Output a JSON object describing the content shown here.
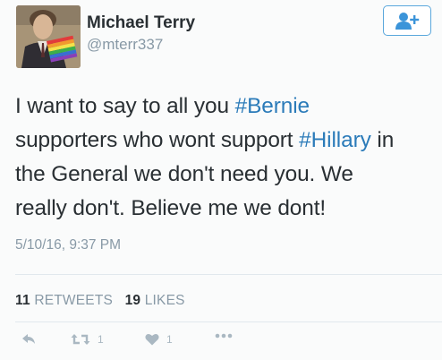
{
  "user": {
    "display_name": "Michael Terry",
    "handle": "@mterr337"
  },
  "follow_button": {
    "icon": "add-user-icon"
  },
  "tweet": {
    "text_parts": [
      "I want to say to all you ",
      "#Bernie",
      "\nsupporters who wont support ",
      "#Hillary",
      " in\nthe General we don't need you. We\nreally don't. Believe me we dont!"
    ],
    "timestamp": "5/10/16, 9:37 PM"
  },
  "stats": {
    "retweets_count": "11",
    "retweets_label": "RETWEETS",
    "likes_count": "19",
    "likes_label": "LIKES"
  },
  "actions": {
    "reply_icon": "reply-icon",
    "retweet_icon": "retweet-icon",
    "retweet_count": "1",
    "like_icon": "heart-icon",
    "like_count": "1",
    "more_icon": "more-dots-icon"
  },
  "colors": {
    "link": "#2b7bb9",
    "muted": "#8899a6",
    "follow_border": "#5aa7dc"
  }
}
